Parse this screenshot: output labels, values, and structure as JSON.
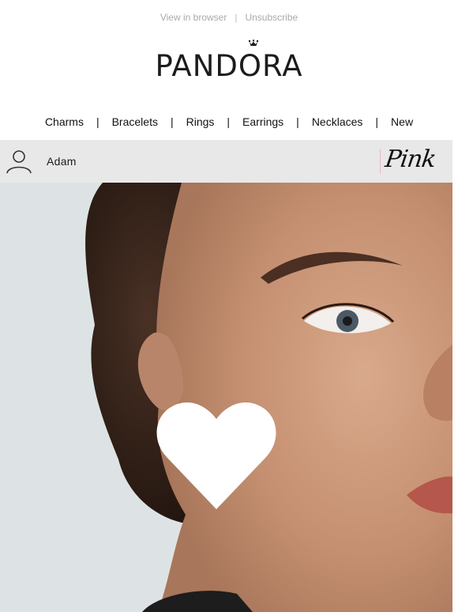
{
  "topbar": {
    "view_in_browser": "View in browser",
    "separator": "|",
    "unsubscribe": "Unsubscribe"
  },
  "brand": {
    "logo_text": "PANDORA"
  },
  "nav": {
    "items": [
      "Charms",
      "Bracelets",
      "Rings",
      "Earrings",
      "Necklaces",
      "New"
    ],
    "separator": "|"
  },
  "user": {
    "name": "Adam",
    "icon": "user-icon"
  },
  "campaign": {
    "label": "Pink",
    "accent_color": "#e9b7c3"
  },
  "hero": {
    "icon": "heart-icon",
    "background_color": "#dde3e4"
  }
}
